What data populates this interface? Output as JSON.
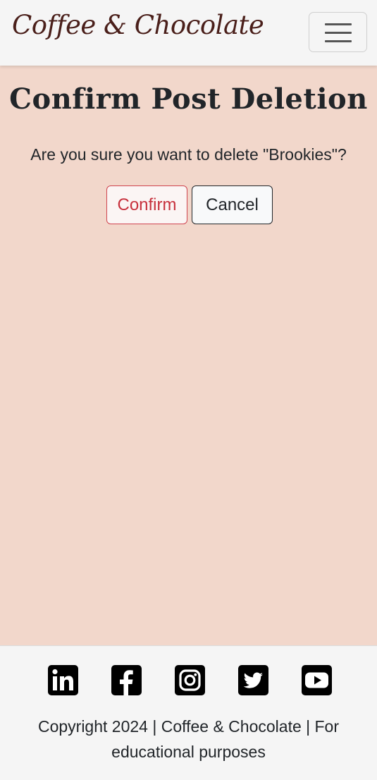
{
  "navbar": {
    "brand": "Coffee & Chocolate",
    "toggle_icon": "hamburger-menu-icon"
  },
  "main": {
    "title": "Confirm Post Deletion",
    "prompt": "Are you sure you want to delete \"Brookies\"?",
    "confirm_label": "Confirm",
    "cancel_label": "Cancel"
  },
  "footer": {
    "social_icons": [
      "linkedin-icon",
      "facebook-icon",
      "instagram-icon",
      "twitter-icon",
      "youtube-icon"
    ],
    "copyright": "Copyright 2024 | Coffee & Chocolate | For educational purposes"
  },
  "colors": {
    "page_background": "#f2d7cb",
    "navbar_background": "#f5f5f5",
    "brand_color": "#4a1f1a",
    "danger": "#c7313d"
  }
}
